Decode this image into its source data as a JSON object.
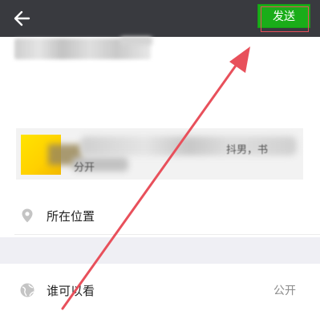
{
  "header": {
    "send_label": "发送",
    "back_icon": "arrow-left-icon"
  },
  "link_card": {
    "visible_fragment_1": "抖男，书",
    "visible_fragment_2": "分开"
  },
  "location": {
    "icon": "location-pin-icon",
    "label": "所在位置"
  },
  "visibility": {
    "icon": "globe-icon",
    "label": "谁可以看",
    "value": "公开"
  },
  "colors": {
    "title_bar": "#393a3f",
    "send_button": "#1aad19",
    "annotation_red": "#e8505b",
    "gap_gray": "#efeff4"
  }
}
